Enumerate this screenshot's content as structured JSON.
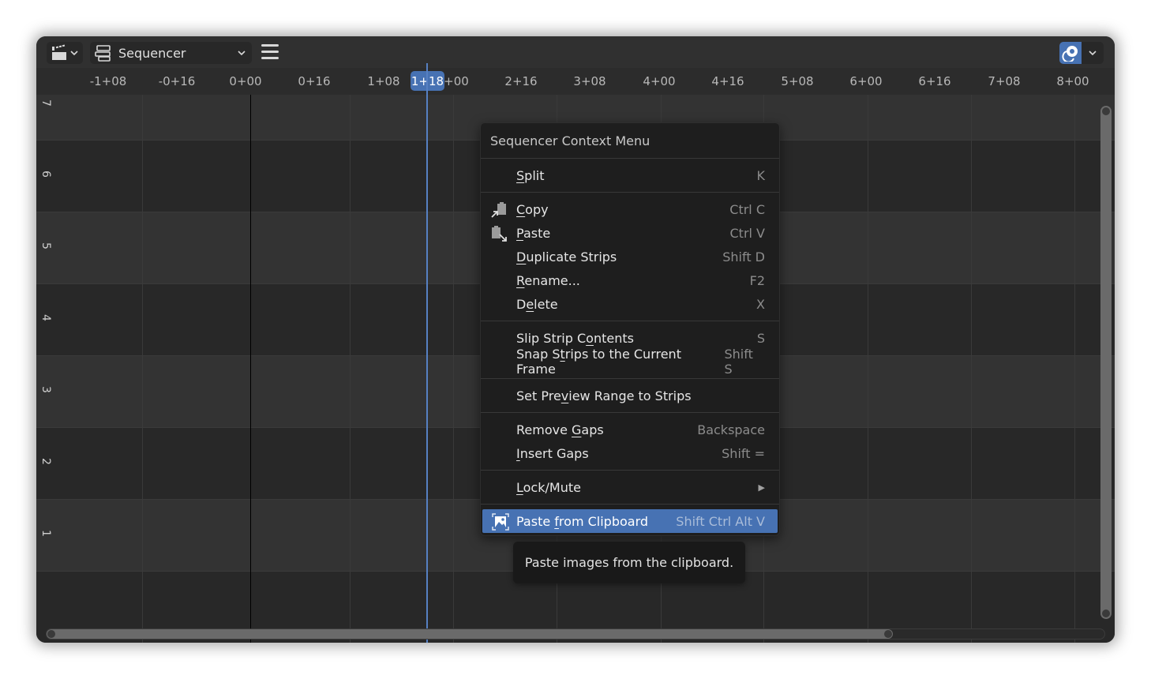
{
  "header": {
    "editor_type_icon": "clapperboard-icon",
    "mode_icon": "sequencer-strips-icon",
    "mode_label": "Sequencer",
    "menu_icon": "hamburger-menu-icon",
    "overlay_icon": "overlay-toggle-icon",
    "accent_color": "#4772b3"
  },
  "ruler": {
    "ticks": [
      "-1+08",
      "-0+16",
      "0+00",
      "0+16",
      "1+08",
      "1+18",
      "+00",
      "2+16",
      "3+08",
      "4+00",
      "4+16",
      "5+08",
      "6+00",
      "6+16",
      "7+08",
      "8+00"
    ],
    "current_frame": "1+18"
  },
  "channels": [
    "7",
    "6",
    "5",
    "4",
    "3",
    "2",
    "1"
  ],
  "context_menu": {
    "title": "Sequencer Context Menu",
    "groups": [
      [
        {
          "label": "Split",
          "underline": "S",
          "shortcut": "K"
        }
      ],
      [
        {
          "label": "Copy",
          "underline": "C",
          "shortcut": "Ctrl C",
          "icon": "copy-icon"
        },
        {
          "label": "Paste",
          "underline": "P",
          "shortcut": "Ctrl V",
          "icon": "paste-icon"
        },
        {
          "label": "Duplicate Strips",
          "underline": "D",
          "shortcut": "Shift D"
        },
        {
          "label": "Rename...",
          "underline": "R",
          "shortcut": "F2"
        },
        {
          "label": "Delete",
          "underline": "e",
          "shortcut": "X"
        }
      ],
      [
        {
          "label": "Slip Strip Contents",
          "underline": "o",
          "shortcut": "S"
        },
        {
          "label": "Snap Strips to the Current Frame",
          "underline": "t",
          "shortcut": "Shift S"
        }
      ],
      [
        {
          "label": "Set Preview Range to Strips",
          "underline": "v",
          "shortcut": ""
        }
      ],
      [
        {
          "label": "Remove Gaps",
          "underline": "G",
          "shortcut": "Backspace"
        },
        {
          "label": "Insert Gaps",
          "underline": "I",
          "shortcut": "Shift ="
        }
      ],
      [
        {
          "label": "Lock/Mute",
          "underline": "L",
          "shortcut": "",
          "submenu": true
        }
      ],
      [
        {
          "label": "Paste from Clipboard",
          "underline": "f",
          "shortcut": "Shift Ctrl Alt V",
          "icon": "image-paste-icon",
          "active": true
        }
      ]
    ]
  },
  "tooltip": {
    "text": "Paste images from the clipboard."
  }
}
